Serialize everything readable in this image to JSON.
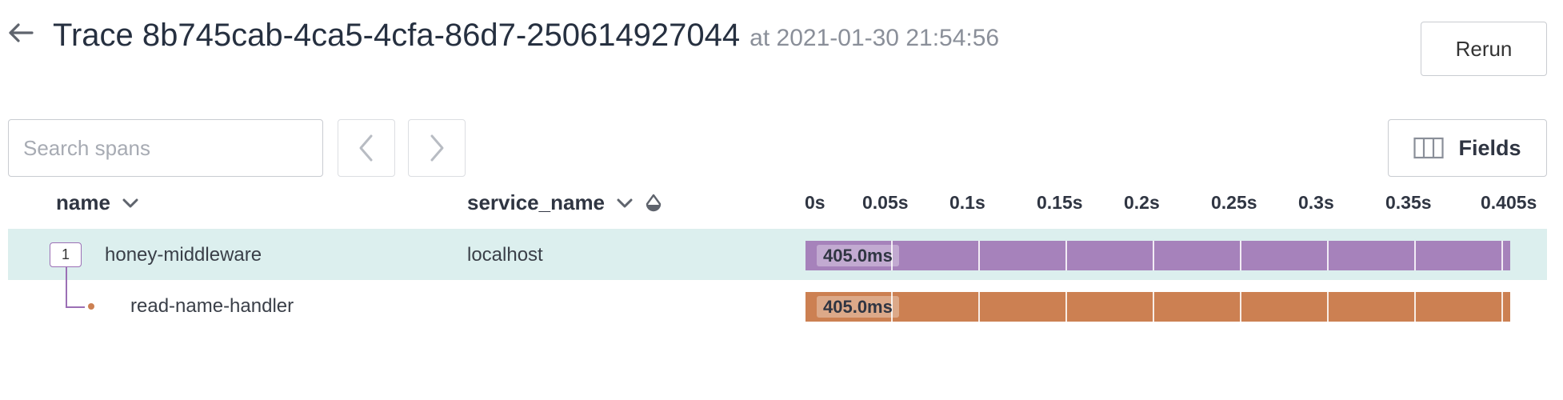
{
  "header": {
    "title": "Trace 8b745cab-4ca5-4cfa-86d7-250614927044",
    "subtitle": "at 2021-01-30 21:54:56",
    "back_icon": "arrow-left-icon",
    "rerun_label": "Rerun"
  },
  "toolbar": {
    "search_placeholder": "Search spans",
    "search_value": "",
    "prev_icon": "chevron-left-icon",
    "next_icon": "chevron-right-icon",
    "fields_label": "Fields",
    "fields_icon": "columns-icon"
  },
  "columns": {
    "name": "name",
    "service_name": "service_name",
    "sort_icon": "chevron-down-icon",
    "color_icon": "droplet-icon"
  },
  "timeline": {
    "ticks": [
      "0s",
      "0.05s",
      "0.1s",
      "0.15s",
      "0.2s",
      "0.25s",
      "0.3s",
      "0.35s",
      "0.405s"
    ]
  },
  "spans": [
    {
      "depth_badge": "1",
      "name": "honey-middleware",
      "service": "localhost",
      "duration_label": "405.0ms",
      "duration_fraction": 1.0,
      "color": "#a682bb",
      "selected": true
    },
    {
      "depth_badge": "",
      "name": "read-name-handler",
      "service": "",
      "duration_label": "405.0ms",
      "duration_fraction": 1.0,
      "color": "#cc8052",
      "selected": false
    }
  ],
  "colors": {
    "selected_row": "#dcefee",
    "tree_line": "#9b6fb5"
  }
}
